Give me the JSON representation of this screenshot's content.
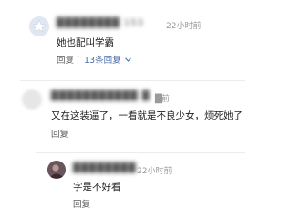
{
  "comments": [
    {
      "username": "████████ 153",
      "time": "22小时前",
      "text": "她也配叫学霸",
      "reply_label": "回复",
      "sep": "·",
      "replies_label": "13条回复"
    },
    {
      "username": "███████████ █",
      "time": "█前",
      "text": "又在这装逼了，一看就是不良少女，烦死她了",
      "reply_label": "回复"
    },
    {
      "username": "████████",
      "time": "22小时前",
      "text": "字是不好看",
      "reply_label": "回复"
    }
  ]
}
